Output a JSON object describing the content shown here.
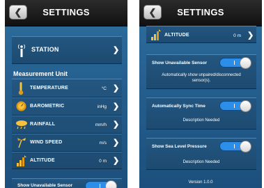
{
  "left": {
    "title": "SETTINGS",
    "back_label": "❮",
    "station_label": "STATION",
    "section_heading": "Measurement Unit",
    "units": [
      {
        "label": "TEMPERATURE",
        "value": "°C",
        "icon": "thermometer-icon"
      },
      {
        "label": "BAROMETRIC",
        "value": "inHg",
        "icon": "barometer-icon"
      },
      {
        "label": "RAINFALL",
        "value": "mm/h",
        "icon": "rain-cloud-icon"
      },
      {
        "label": "WIND SPEED",
        "value": "m/s",
        "icon": "wind-icon"
      },
      {
        "label": "ALTITUDE",
        "value": "0 m",
        "icon": "altitude-icon"
      }
    ],
    "bottom_switch_label": "Show Unavailable Sensor"
  },
  "right": {
    "title": "SETTINGS",
    "back_label": "❮",
    "altitude_label": "ALTITUDE",
    "altitude_value": "0 m",
    "switches": [
      {
        "label": "Show Unavailable Sensor",
        "description": "Automatically show unpaired/disconnected sensor(s).",
        "on": true
      },
      {
        "label": "Automatically Sync Time",
        "description": "Description Needed",
        "on": true
      },
      {
        "label": "Show Sea Level Pressure",
        "description": "Description Needed",
        "on": true
      }
    ],
    "version": "Version 1.0.0"
  },
  "chevron": "❯",
  "colors": {
    "background": "#2a6594",
    "toggle_on": "#2c8ee8",
    "nav_bar": "#1a1a1a"
  }
}
